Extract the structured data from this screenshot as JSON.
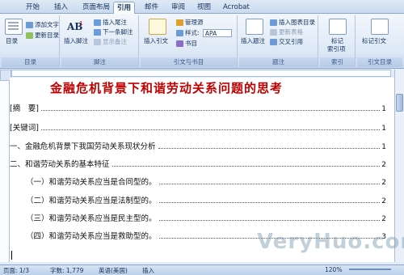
{
  "ribbon_tabs": [
    "开始",
    "插入",
    "页面布局",
    "引用",
    "邮件",
    "审阅",
    "视图",
    "Acrobat"
  ],
  "active_tab": "引用",
  "groups": {
    "toc": {
      "label": "目录",
      "btn_toc": "目录",
      "btn_add_text": "添加文字",
      "btn_update": "更新目录"
    },
    "footnote": {
      "label": "脚注",
      "btn_insert_footnote": "插入脚注",
      "btn_insert_endnote": "插入尾注",
      "btn_next_footnote": "下一条脚注",
      "btn_show_notes": "显示备注"
    },
    "citation": {
      "label": "引文与书目",
      "btn_insert_citation": "插入引文",
      "btn_manage_sources": "管理源",
      "style_label": "样式:",
      "style_value": "APA",
      "btn_bibliography": "书目"
    },
    "caption": {
      "label": "题注",
      "btn_insert_caption": "插入题注",
      "btn_insert_table_of_figures": "插入图表目录",
      "btn_update_table": "更新表格",
      "btn_cross_reference": "交叉引用"
    },
    "index": {
      "label": "索引",
      "btn_mark_entry": "标记",
      "btn_mark_entry_2": "索引项"
    },
    "authorities": {
      "label": "引文目录",
      "btn_mark_citation": "标记引文"
    }
  },
  "document": {
    "title": "金融危机背景下和谐劳动关系问题的思考",
    "toc_entries": [
      {
        "text": "[摘　要]",
        "page": "1"
      },
      {
        "text": "[关键词]",
        "page": "1"
      },
      {
        "text": "一、金融危机背景下我国劳动关系现状分析",
        "page": "1"
      },
      {
        "text": "二、和谐劳动关系的基本特征",
        "page": "2"
      },
      {
        "text": "（一）和谐劳动关系应当是合同型的。",
        "page": "2"
      },
      {
        "text": "（二）和谐劳动关系应当是法制型的。",
        "page": "2"
      },
      {
        "text": "（三）和谐劳动关系应当是民主型的。",
        "page": "2"
      },
      {
        "text": "（四）和谐劳动关系应当是救助型的。",
        "page": "3"
      }
    ]
  },
  "status_bar": {
    "page": "页面: 1/3",
    "words": "字数: 1,779",
    "language": "英语(美国)",
    "mode": "插入",
    "zoom": "120%"
  },
  "watermark": "VeryHuo.com",
  "colors": {
    "title": "#c00000",
    "ribbon_bg": "#dde8f6",
    "accent": "#2b579a"
  }
}
